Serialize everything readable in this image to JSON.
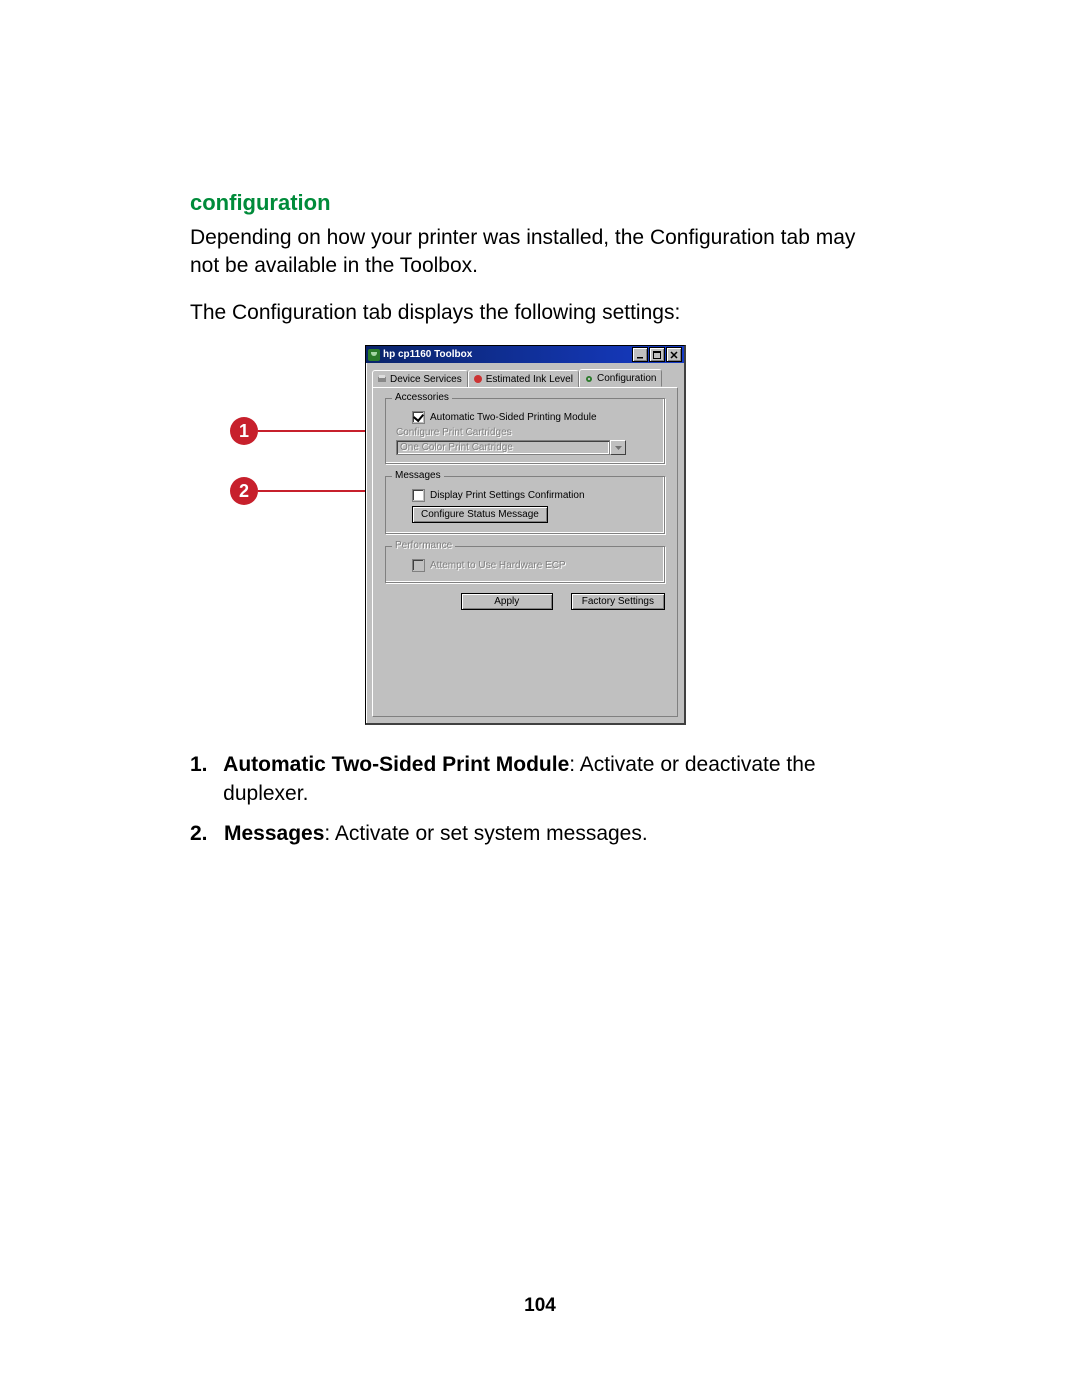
{
  "doc": {
    "heading": "configuration",
    "para1": "Depending on how your printer was installed, the Configuration tab may not be available in the Toolbox.",
    "para2": "The Configuration tab displays the following settings:",
    "page_number": "104"
  },
  "callouts": {
    "c1": "1",
    "c2": "2"
  },
  "dialog": {
    "title": "hp cp1160 Toolbox",
    "tabs": {
      "services": "Device Services",
      "ink": "Estimated Ink Level",
      "config": "Configuration"
    },
    "accessories": {
      "legend": "Accessories",
      "chk_label": "Automatic Two-Sided Printing Module",
      "sub_label": "Configure Print Cartridges",
      "dd_value": "One Color Print Cartridge"
    },
    "messages": {
      "legend": "Messages",
      "chk_label": "Display Print Settings Confirmation",
      "btn_label": "Configure Status Message"
    },
    "performance": {
      "legend": "Performance",
      "chk_label": "Attempt to Use Hardware ECP"
    },
    "buttons": {
      "apply": "Apply",
      "factory": "Factory Settings"
    }
  },
  "legend": {
    "i1_num": "1.",
    "i1_bold": "Automatic Two-Sided Print Module",
    "i1_rest": ": Activate or deactivate the duplexer.",
    "i2_num": "2.",
    "i2_bold": "Messages",
    "i2_rest": ": Activate or set system messages."
  }
}
